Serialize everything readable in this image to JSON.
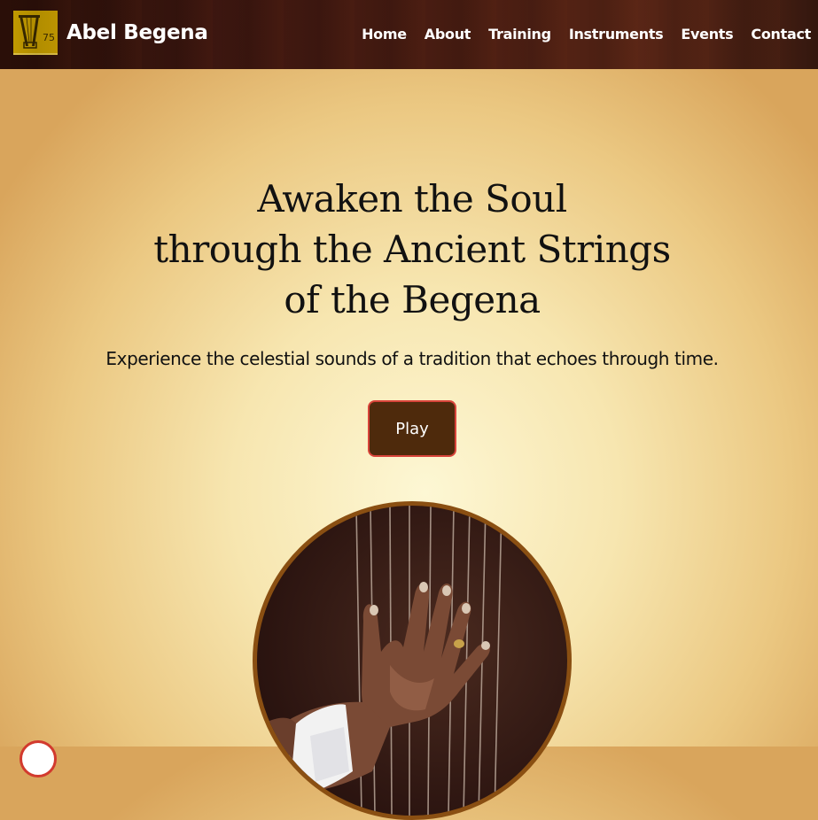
{
  "header": {
    "brand": "Abel Begena",
    "logo_icon": "begena-logo-icon",
    "nav_items": [
      {
        "label": "Home"
      },
      {
        "label": "About"
      },
      {
        "label": "Training"
      },
      {
        "label": "Instruments"
      },
      {
        "label": "Events"
      },
      {
        "label": "Contact"
      }
    ]
  },
  "hero": {
    "title_lines": [
      "Awaken the Soul",
      "through the Ancient Strings",
      "of the Begena"
    ],
    "subtitle": "Experience the celestial sounds of a tradition that echoes through time.",
    "play_label": "Play"
  },
  "colors": {
    "nav_bg": "#3e1710",
    "button_bg": "#4e2a0c",
    "button_border": "#d8443a",
    "photo_border": "#8a4f12",
    "logo_bg": "#c9a000"
  }
}
